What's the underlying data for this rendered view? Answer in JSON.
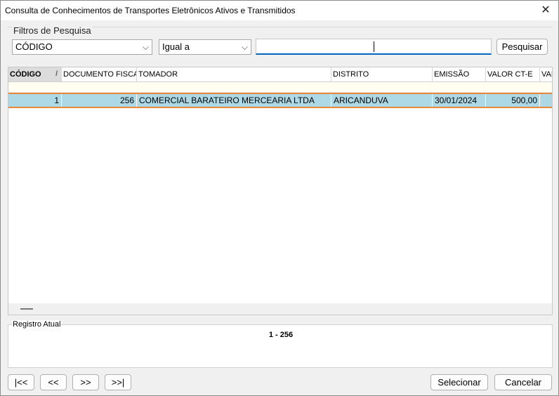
{
  "window": {
    "title": "Consulta de Conhecimentos de Transportes Eletrônicos Ativos e Transmitidos",
    "close_glyph": "✕"
  },
  "filters": {
    "legend": "Filtros de Pesquisa",
    "field_value": "CÓDIGO",
    "operator_value": "Igual a",
    "search_value": "",
    "search_button": "Pesquisar",
    "chevron_glyph": "⌵"
  },
  "grid": {
    "sort_glyph": "/",
    "columns": [
      "CÓDIGO",
      "DOCUMENTO FISCAL",
      "TOMADOR",
      "DISTRITO",
      "EMISSÃO",
      "VALOR CT-E",
      "VAL"
    ],
    "rows": [
      {
        "codigo": "1",
        "documento_fiscal": "256",
        "tomador": "COMERCIAL BARATEIRO MERCEARIA LTDA",
        "distrito": "ARICANDUVA",
        "emissao": "30/01/2024",
        "valor_cte": "500,00",
        "val": ""
      }
    ]
  },
  "registro": {
    "legend": "Registro Atual",
    "value": "1 - 256"
  },
  "footer": {
    "first": "|<<",
    "prev": "<<",
    "next": ">>",
    "last": ">>|",
    "select": "Selecionar",
    "cancel": "Cancelar"
  },
  "colors": {
    "selected_row": "#add8e6",
    "focus_outline": "#e8883a",
    "input_underline": "#0067c0"
  }
}
